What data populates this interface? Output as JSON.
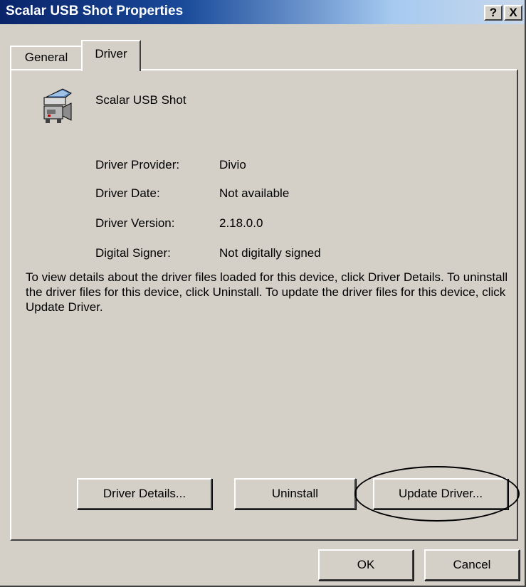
{
  "window": {
    "title": "Scalar USB Shot Properties",
    "help_label": "?",
    "close_label": "X"
  },
  "tabs": [
    {
      "label": "General",
      "active": false
    },
    {
      "label": "Driver",
      "active": true
    }
  ],
  "device": {
    "icon": "camera-scanner-icon",
    "name": "Scalar USB Shot"
  },
  "properties": [
    {
      "label": "Driver Provider:",
      "value": "Divio"
    },
    {
      "label": "Driver Date:",
      "value": "Not available"
    },
    {
      "label": "Driver Version:",
      "value": "2.18.0.0"
    },
    {
      "label": "Digital Signer:",
      "value": "Not digitally signed"
    }
  ],
  "description": "To view details about the driver files loaded for this device, click Driver Details. To uninstall the driver files for this device, click Uninstall. To update the driver files for this device, click Update Driver.",
  "buttons": {
    "driver_details": "Driver Details...",
    "uninstall": "Uninstall",
    "update_driver": "Update Driver...",
    "ok": "OK",
    "cancel": "Cancel"
  },
  "colors": {
    "title_start": "#0a246a",
    "title_end": "#c8d8ec",
    "face": "#d4d0c8"
  }
}
